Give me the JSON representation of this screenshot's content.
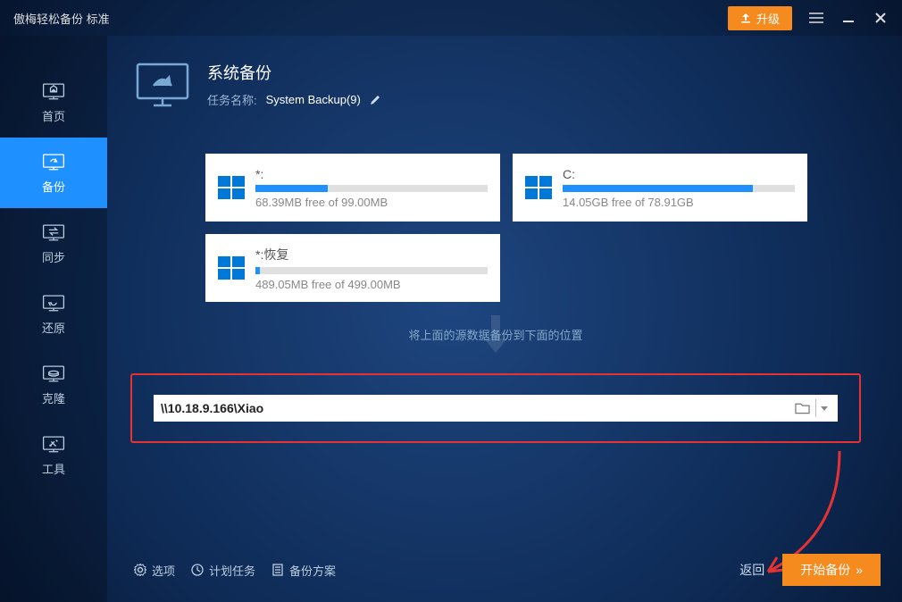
{
  "app_title": "傲梅轻松备份 标准",
  "titlebar": {
    "upgrade": "升级"
  },
  "sidebar": {
    "items": [
      {
        "label": "首页"
      },
      {
        "label": "备份"
      },
      {
        "label": "同步"
      },
      {
        "label": "还原"
      },
      {
        "label": "克隆"
      },
      {
        "label": "工具"
      }
    ]
  },
  "header": {
    "title": "系统备份",
    "task_label": "任务名称:",
    "task_value": "System Backup(9)"
  },
  "drives": [
    {
      "label": "*:",
      "free": "68.39MB free of 99.00MB",
      "pct": 31
    },
    {
      "label": "C:",
      "free": "14.05GB free of 78.91GB",
      "pct": 82
    },
    {
      "label": "*:恢复",
      "free": "489.05MB free of 499.00MB",
      "pct": 2
    }
  ],
  "arrow_caption": "将上面的源数据备份到下面的位置",
  "destination": {
    "path": "\\\\10.18.9.166\\Xiao"
  },
  "footer": {
    "options": "选项",
    "schedule": "计划任务",
    "scheme": "备份方案",
    "back": "返回",
    "start": "开始备份"
  }
}
